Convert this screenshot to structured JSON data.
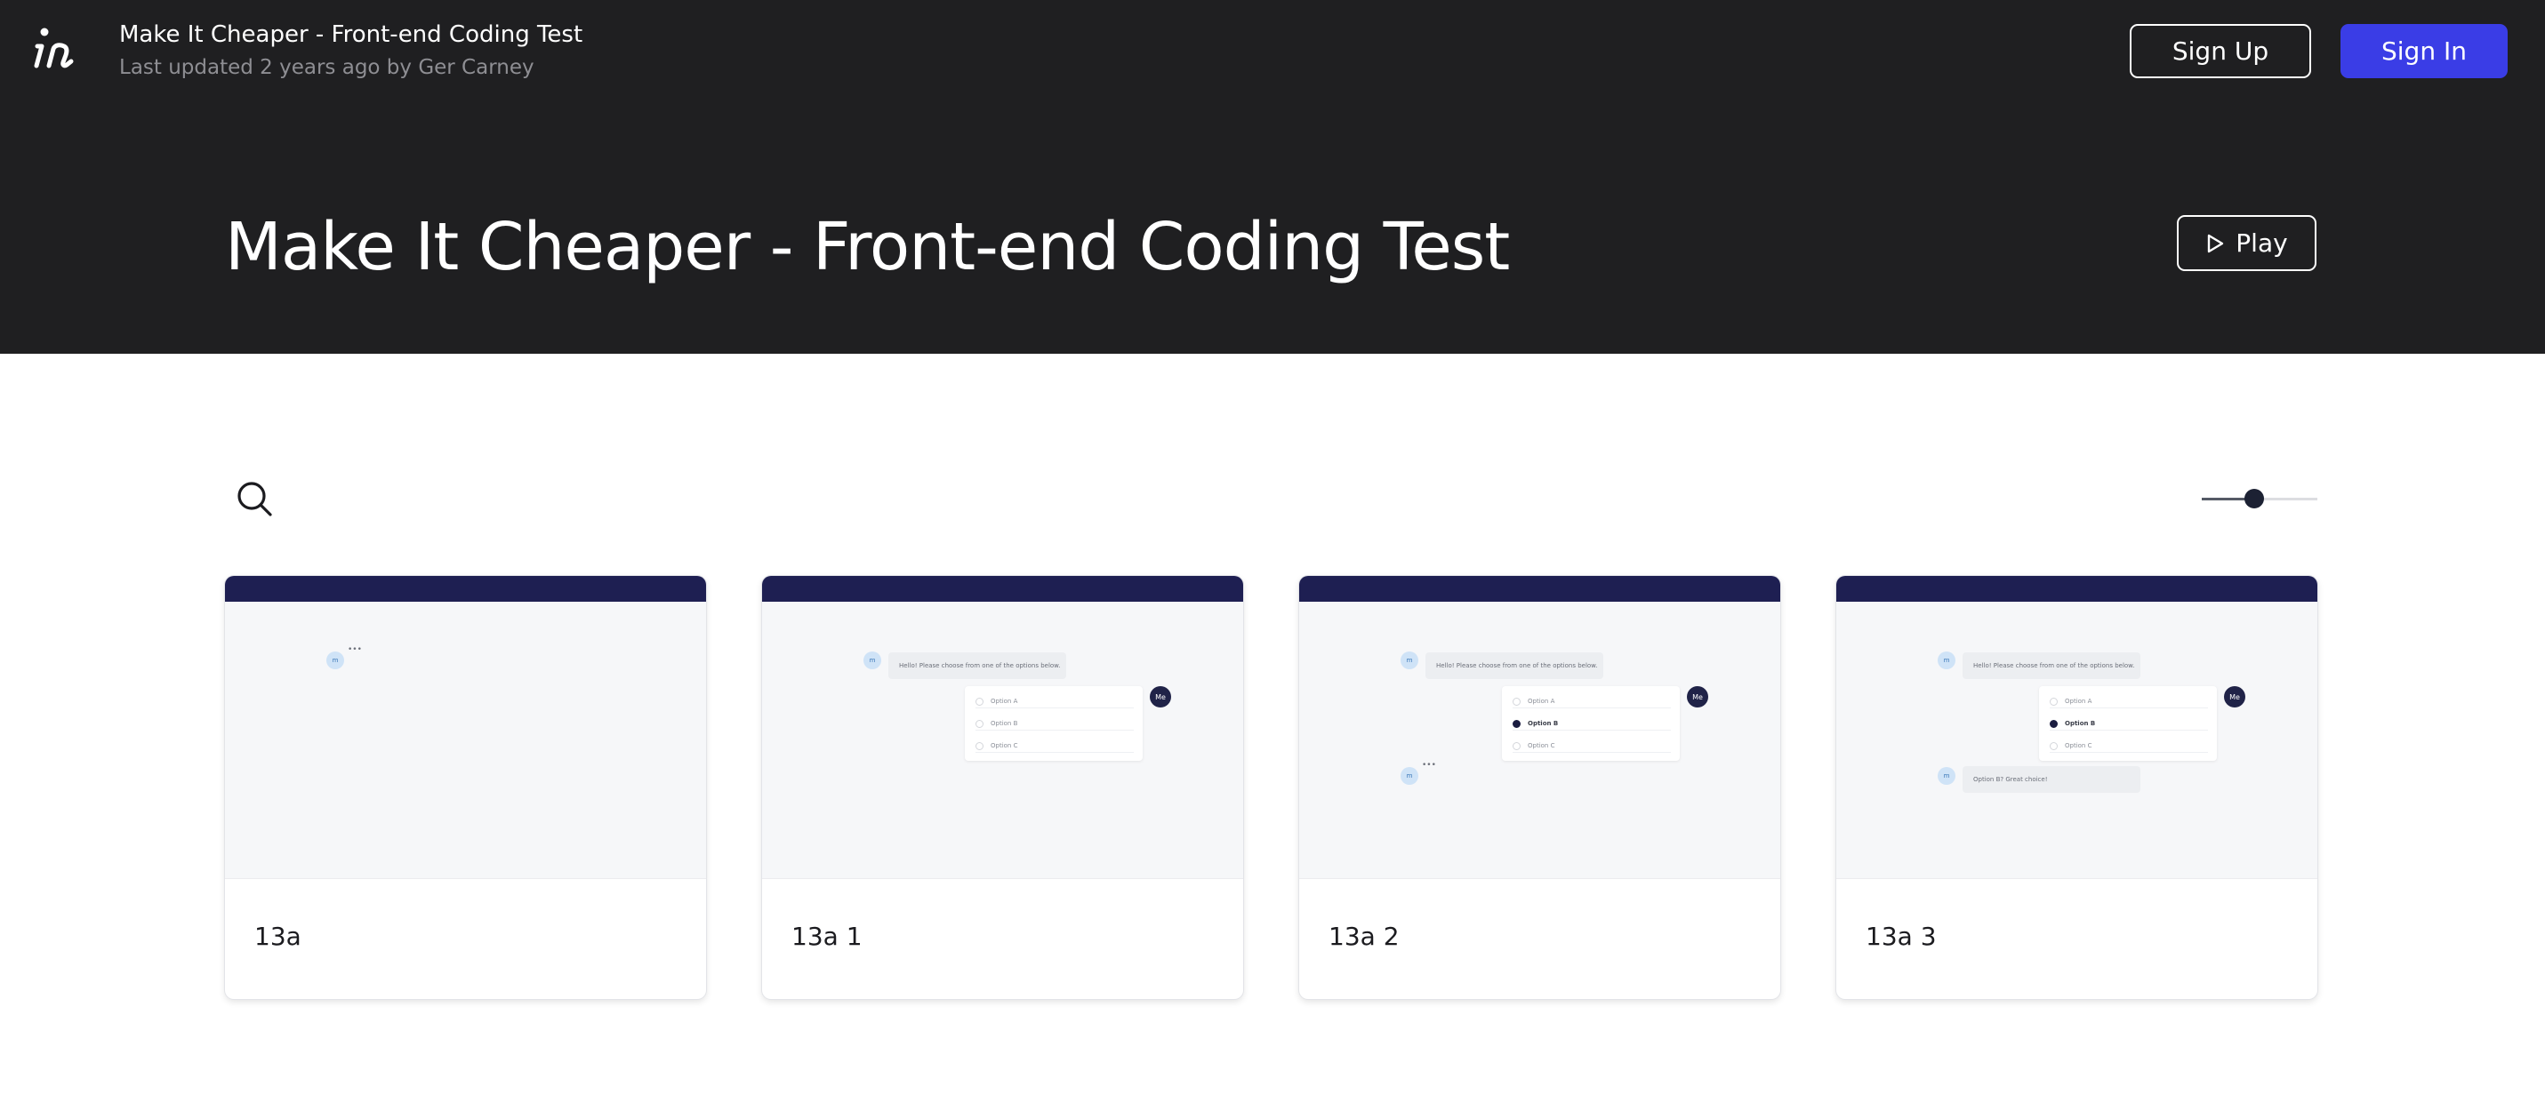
{
  "header": {
    "project_title": "Make It Cheaper - Front-end Coding Test",
    "last_updated": "Last updated 2 years ago by Ger Carney",
    "signup_label": "Sign Up",
    "signin_label": "Sign In"
  },
  "hero": {
    "title": "Make It Cheaper - Front-end Coding Test",
    "play_label": "Play"
  },
  "toolbar": {
    "zoom_level": 0.45
  },
  "screens": [
    {
      "name": "13a",
      "preview": {
        "avatar": "m",
        "typing": "•••"
      }
    },
    {
      "name": "13a 1",
      "preview": {
        "avatar": "m",
        "message": "Hello! Please choose from one of the options below.",
        "me": "Me",
        "options": [
          "Option A",
          "Option B",
          "Option C"
        ]
      }
    },
    {
      "name": "13a 2",
      "preview": {
        "avatar": "m",
        "message": "Hello! Please choose from one of the options below.",
        "me": "Me",
        "options": [
          "Option A",
          "Option B",
          "Option C"
        ],
        "selected": "Option B",
        "typing": "•••"
      }
    },
    {
      "name": "13a 3",
      "preview": {
        "avatar": "m",
        "message": "Hello! Please choose from one of the options below.",
        "me": "Me",
        "options": [
          "Option A",
          "Option B",
          "Option C"
        ],
        "selected": "Option B",
        "reply": "Option B? Great choice!"
      }
    }
  ],
  "colors": {
    "header_bg": "#1f1f21",
    "accent": "#3a3de6",
    "thumb_bar": "#1e1f52"
  }
}
